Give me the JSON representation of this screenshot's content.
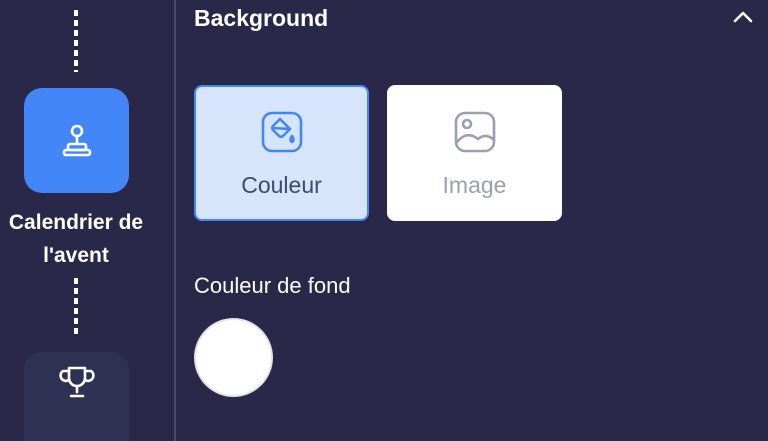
{
  "stepper": {
    "current_step_label": "Calendrier de l'avent",
    "current_step_icon": "joystick-icon",
    "next_step_icon": "trophy-icon"
  },
  "section": {
    "title": "Background",
    "collapse_icon": "chevron-up-icon"
  },
  "background_options": [
    {
      "label": "Couleur",
      "icon": "paint-bucket-icon",
      "selected": true
    },
    {
      "label": "Image",
      "icon": "image-icon",
      "selected": false
    }
  ],
  "color_field": {
    "label": "Couleur de fond",
    "value": "#ffffff"
  },
  "colors": {
    "background": "#2a2848",
    "accent": "#4386f8",
    "selected_fill": "#d6e4fc"
  }
}
